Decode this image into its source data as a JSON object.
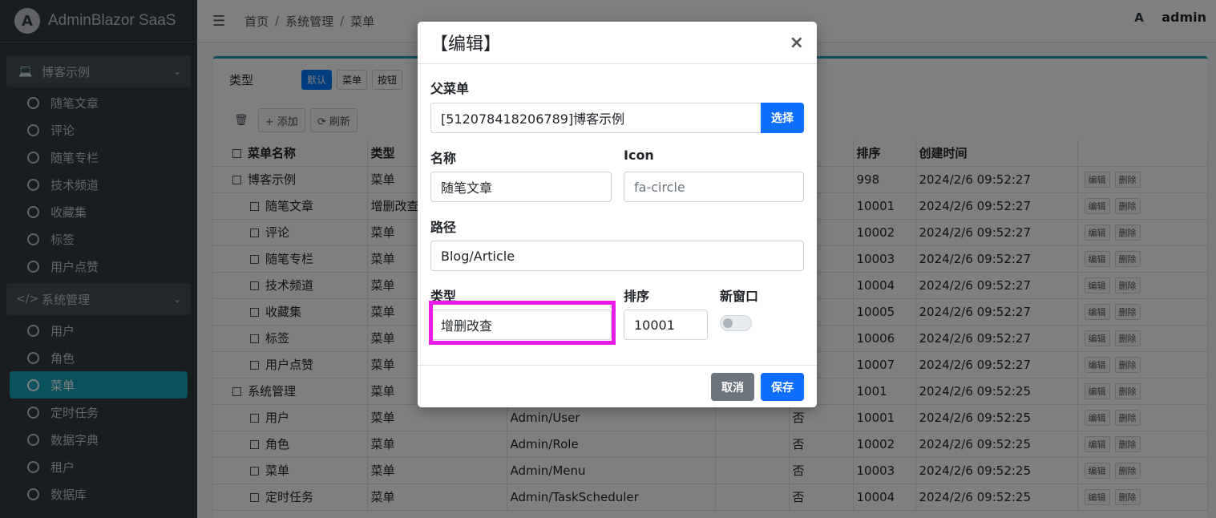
{
  "brand": {
    "logo_letter": "A",
    "name": "AdminBlazor SaaS"
  },
  "sidebar": {
    "groups": [
      {
        "label": "博客示例",
        "icon": "laptop-icon",
        "items": [
          "随笔文章",
          "评论",
          "随笔专栏",
          "技术频道",
          "收藏集",
          "标签",
          "用户点赞"
        ]
      },
      {
        "label": "系统管理",
        "icon": "code-icon",
        "items": [
          "用户",
          "角色",
          "菜单",
          "定时任务",
          "数据字典",
          "租户",
          "数据库"
        ]
      }
    ],
    "active": "菜单"
  },
  "topnav": {
    "breadcrumb": [
      "首页",
      "系统管理",
      "菜单"
    ],
    "user": "admin",
    "user_icon_letter": "A"
  },
  "card": {
    "filter": {
      "label": "类型",
      "chips": [
        "默认",
        "菜单",
        "按钮"
      ]
    },
    "toolbar": {
      "add": "+ 添加",
      "refresh": "⟳ 刷新"
    },
    "columns": [
      "菜单名称",
      "类型",
      "",
      "",
      "口",
      "排序",
      "创建时间",
      ""
    ],
    "actions": {
      "edit": "编辑",
      "delete": "删除"
    },
    "rows": [
      {
        "name": "博客示例",
        "level": 0,
        "type": "菜单",
        "path": "",
        "newwin": "",
        "sort": "998",
        "time": "2024/2/6 09:52:27"
      },
      {
        "name": "随笔文章",
        "level": 1,
        "type": "增删改查",
        "path": "",
        "newwin": "",
        "sort": "10001",
        "time": "2024/2/6 09:52:27"
      },
      {
        "name": "评论",
        "level": 1,
        "type": "菜单",
        "path": "",
        "newwin": "",
        "sort": "10002",
        "time": "2024/2/6 09:52:27"
      },
      {
        "name": "随笔专栏",
        "level": 1,
        "type": "菜单",
        "path": "",
        "newwin": "",
        "sort": "10003",
        "time": "2024/2/6 09:52:27"
      },
      {
        "name": "技术频道",
        "level": 1,
        "type": "菜单",
        "path": "",
        "newwin": "",
        "sort": "10004",
        "time": "2024/2/6 09:52:27"
      },
      {
        "name": "收藏集",
        "level": 1,
        "type": "菜单",
        "path": "",
        "newwin": "",
        "sort": "10005",
        "time": "2024/2/6 09:52:27"
      },
      {
        "name": "标签",
        "level": 1,
        "type": "菜单",
        "path": "",
        "newwin": "",
        "sort": "10006",
        "time": "2024/2/6 09:52:27"
      },
      {
        "name": "用户点赞",
        "level": 1,
        "type": "菜单",
        "path": "",
        "newwin": "",
        "sort": "10007",
        "time": "2024/2/6 09:52:27"
      },
      {
        "name": "系统管理",
        "level": 0,
        "type": "菜单",
        "path": "",
        "newwin": "",
        "sort": "1001",
        "time": "2024/2/6 09:52:25"
      },
      {
        "name": "用户",
        "level": 1,
        "type": "菜单",
        "path": "Admin/User",
        "newwin": "否",
        "sort": "10001",
        "time": "2024/2/6 09:52:25"
      },
      {
        "name": "角色",
        "level": 1,
        "type": "菜单",
        "path": "Admin/Role",
        "newwin": "否",
        "sort": "10002",
        "time": "2024/2/6 09:52:25"
      },
      {
        "name": "菜单",
        "level": 1,
        "type": "菜单",
        "path": "Admin/Menu",
        "newwin": "否",
        "sort": "10003",
        "time": "2024/2/6 09:52:25"
      },
      {
        "name": "定时任务",
        "level": 1,
        "type": "菜单",
        "path": "Admin/TaskScheduler",
        "newwin": "否",
        "sort": "10004",
        "time": "2024/2/6 09:52:25"
      }
    ]
  },
  "modal": {
    "title": "【编辑】",
    "close": "×",
    "parent_label": "父菜单",
    "parent_value": "[512078418206789]博客示例",
    "select_btn": "选择",
    "name_label": "名称",
    "name_value": "随笔文章",
    "icon_label": "Icon",
    "icon_placeholder": "fa-circle",
    "path_label": "路径",
    "path_value": "Blog/Article",
    "type_label": "类型",
    "type_value": "增删改查",
    "sort_label": "排序",
    "sort_value": "10001",
    "newwin_label": "新窗口",
    "newwin_on": false,
    "cancel": "取消",
    "save": "保存"
  }
}
